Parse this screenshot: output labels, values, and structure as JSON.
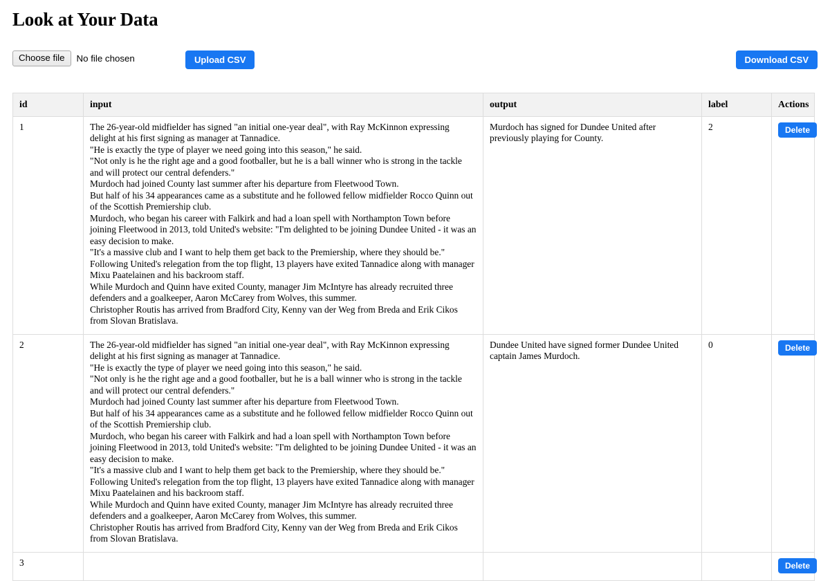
{
  "page": {
    "title": "Look at Your Data"
  },
  "toolbar": {
    "choose_file_label": "Choose file",
    "no_file_text": "No file chosen",
    "upload_label": "Upload CSV",
    "download_label": "Download CSV",
    "accent_color": "#1877f2"
  },
  "table": {
    "columns": [
      {
        "key": "id",
        "label": "id"
      },
      {
        "key": "input",
        "label": "input"
      },
      {
        "key": "output",
        "label": "output"
      },
      {
        "key": "label",
        "label": "label"
      },
      {
        "key": "actions",
        "label": "Actions"
      }
    ],
    "header_background": "#f2f2f2",
    "border_color": "#dddddd",
    "action_label": "Delete",
    "rows": [
      {
        "id": "1",
        "input": "The 26-year-old midfielder has signed \"an initial one-year deal\", with Ray McKinnon expressing delight at his first signing as manager at Tannadice.\n\"He is exactly the type of player we need going into this season,\" he said.\n\"Not only is he the right age and a good footballer, but he is a ball winner who is strong in the tackle and will protect our central defenders.\"\nMurdoch had joined County last summer after his departure from Fleetwood Town.\nBut half of his 34 appearances came as a substitute and he followed fellow midfielder Rocco Quinn out of the Scottish Premiership club.\nMurdoch, who began his career with Falkirk and had a loan spell with Northampton Town before joining Fleetwood in 2013, told United's website: \"I'm delighted to be joining Dundee United - it was an easy decision to make.\n\"It's a massive club and I want to help them get back to the Premiership, where they should be.\"\nFollowing United's relegation from the top flight, 13 players have exited Tannadice along with manager Mixu Paatelainen and his backroom staff.\nWhile Murdoch and Quinn have exited County, manager Jim McIntyre has already recruited three defenders and a goalkeeper, Aaron McCarey from Wolves, this summer.\nChristopher Routis has arrived from Bradford City, Kenny van der Weg from Breda and Erik Cikos from Slovan Bratislava.",
        "output": "Murdoch has signed for Dundee United after previously playing for County.",
        "label": "2",
        "action": "Delete"
      },
      {
        "id": "2",
        "input": "The 26-year-old midfielder has signed \"an initial one-year deal\", with Ray McKinnon expressing delight at his first signing as manager at Tannadice.\n\"He is exactly the type of player we need going into this season,\" he said.\n\"Not only is he the right age and a good footballer, but he is a ball winner who is strong in the tackle and will protect our central defenders.\"\nMurdoch had joined County last summer after his departure from Fleetwood Town.\nBut half of his 34 appearances came as a substitute and he followed fellow midfielder Rocco Quinn out of the Scottish Premiership club.\nMurdoch, who began his career with Falkirk and had a loan spell with Northampton Town before joining Fleetwood in 2013, told United's website: \"I'm delighted to be joining Dundee United - it was an easy decision to make.\n\"It's a massive club and I want to help them get back to the Premiership, where they should be.\"\nFollowing United's relegation from the top flight, 13 players have exited Tannadice along with manager Mixu Paatelainen and his backroom staff.\nWhile Murdoch and Quinn have exited County, manager Jim McIntyre has already recruited three defenders and a goalkeeper, Aaron McCarey from Wolves, this summer.\nChristopher Routis has arrived from Bradford City, Kenny van der Weg from Breda and Erik Cikos from Slovan Bratislava.",
        "output": "Dundee United have signed former Dundee United captain James Murdoch.",
        "label": "0",
        "action": "Delete"
      },
      {
        "id": "3",
        "input": "",
        "output": "",
        "label": "",
        "action": "Delete"
      }
    ]
  }
}
